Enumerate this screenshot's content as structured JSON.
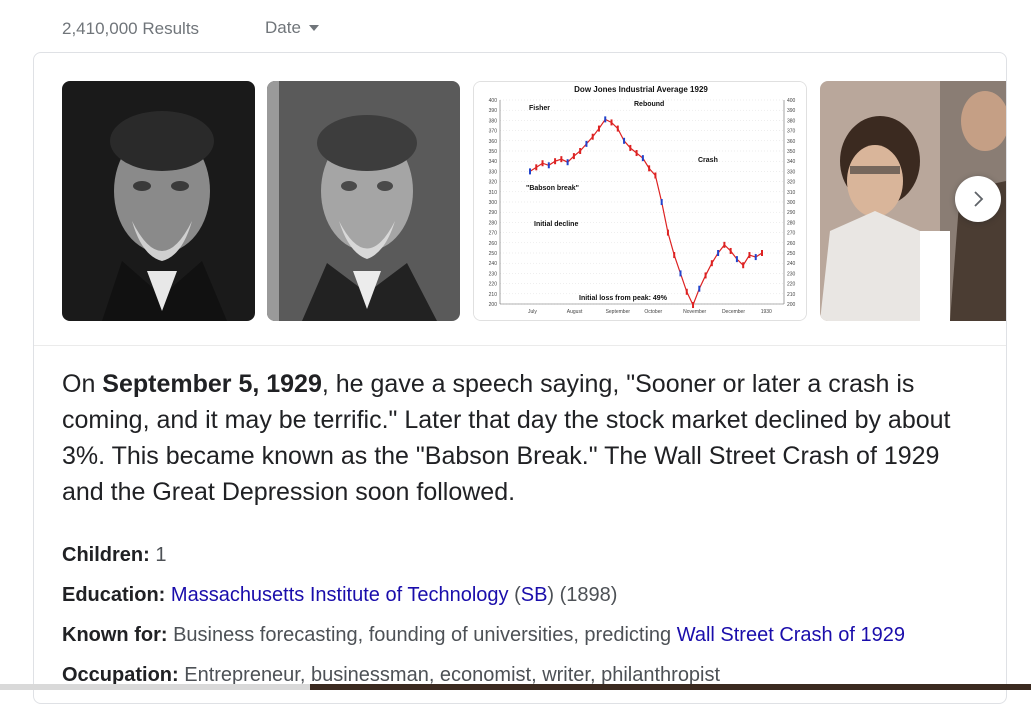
{
  "results": {
    "count": "2,410,000 Results",
    "date_filter": "Date"
  },
  "gallery": {
    "thumbs": [
      {
        "name": "portrait-photo-1"
      },
      {
        "name": "portrait-photo-2"
      },
      {
        "name": "dow-jones-chart-image",
        "chart_data": {
          "type": "line",
          "title": "Dow Jones Industrial Average 1929",
          "annotations": [
            "Fisher",
            "Rebound",
            "Crash",
            "\"Babson break\"",
            "Initial decline",
            "Initial loss from peak: 49%"
          ],
          "x_labels": [
            "July",
            "August",
            "September",
            "October",
            "November",
            "December",
            "1930"
          ],
          "y_ticks": [
            400,
            390,
            380,
            370,
            360,
            350,
            340,
            330,
            320,
            310,
            300,
            290,
            280,
            270,
            260,
            250,
            240,
            230,
            220,
            210,
            200
          ],
          "ylim": [
            200,
            400
          ],
          "series": [
            {
              "values": [
                330,
                334,
                338,
                336,
                340,
                342,
                339,
                345,
                350,
                357,
                364,
                372,
                381,
                378,
                372,
                360,
                353,
                348,
                343,
                333,
                326,
                300,
                270,
                248,
                230,
                212,
                199,
                215,
                228,
                240,
                250,
                258,
                252,
                244,
                238,
                248,
                246,
                250
              ]
            }
          ]
        }
      },
      {
        "name": "woman-photo"
      }
    ],
    "next_label": "Next"
  },
  "description": {
    "part1": "On ",
    "bold": "September 5, 1929",
    "part2": ", he gave a speech saying, \"Sooner or later a crash is coming, and it may be terrific.\" Later that day the stock market declined by about 3%. This became known as the \"Babson Break.\" The Wall Street Crash of 1929 and the Great Depression soon followed."
  },
  "facts": {
    "children": {
      "label": "Children:",
      "value": " 1"
    },
    "education": {
      "label": "Education:",
      "link1": "Massachusetts Institute of Technology",
      "sep1": " (",
      "link2": "SB",
      "sep2": ") (1898)"
    },
    "known_for": {
      "label": "Known for:",
      "value": " Business forecasting, founding of universities, predicting ",
      "link": "Wall Street Crash of 1929"
    },
    "occupation": {
      "label": "Occupation:",
      "value": " Entrepreneur, businessman, economist, writer, philanthropist"
    }
  }
}
